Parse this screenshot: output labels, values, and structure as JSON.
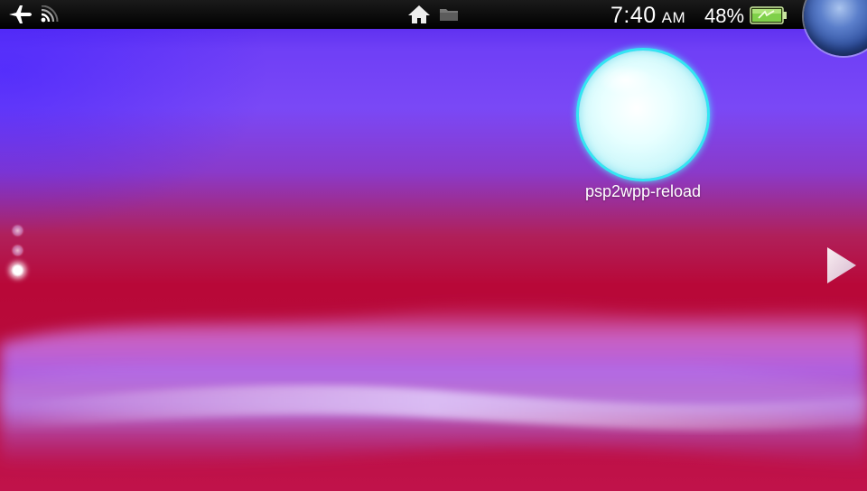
{
  "status_bar": {
    "airplane_icon": "airplane-icon",
    "wifi_icon": "wifi-icon",
    "home_icon": "home-icon",
    "folder_icon": "folder-icon",
    "time": "7:40",
    "ampm": "AM",
    "battery_percent": "48%",
    "battery_icon": "battery-charging-icon",
    "battery_level": 0.48
  },
  "home_screen": {
    "apps": [
      {
        "label": "psp2wpp-reload",
        "icon": "bubble-icon"
      }
    ],
    "page_indicator": {
      "pages": 3,
      "current": 3
    },
    "next_page_icon": "arrow-right-icon"
  },
  "colors": {
    "accent_bubble_glow": "#33e6f2",
    "battery_green": "#7fd04a",
    "background_top": "#4a1ee8",
    "background_bottom": "#c0124a"
  }
}
